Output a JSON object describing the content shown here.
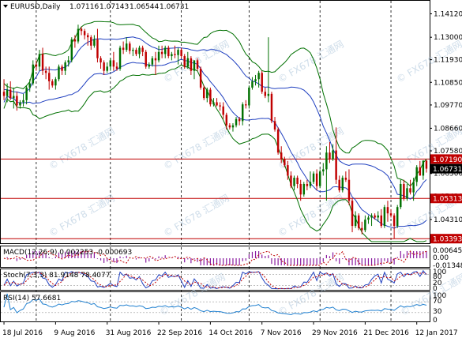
{
  "chart_data": {
    "type": "candlestick",
    "symbol_title": "EURUSD,Daily",
    "ohlc_header": [
      "1.07116",
      "1.07143",
      "1.06544",
      "1.06731"
    ],
    "ohlc": [
      [
        "2016-07-18",
        1.104,
        1.11,
        1.1,
        1.102
      ],
      [
        "2016-07-19",
        1.102,
        1.108,
        1.099,
        1.105
      ],
      [
        "2016-07-20",
        1.105,
        1.109,
        1.1,
        1.101
      ],
      [
        "2016-07-21",
        1.101,
        1.106,
        1.096,
        1.102
      ],
      [
        "2016-07-22",
        1.102,
        1.104,
        1.095,
        1.0975
      ],
      [
        "2016-07-25",
        1.0975,
        1.1,
        1.096,
        1.099
      ],
      [
        "2016-07-26",
        1.099,
        1.103,
        1.097,
        1.1
      ],
      [
        "2016-07-27",
        1.1,
        1.107,
        1.098,
        1.106
      ],
      [
        "2016-07-28",
        1.106,
        1.11,
        1.104,
        1.108
      ],
      [
        "2016-07-29",
        1.108,
        1.119,
        1.107,
        1.117
      ],
      [
        "2016-08-01",
        1.117,
        1.119,
        1.114,
        1.116
      ],
      [
        "2016-08-02",
        1.116,
        1.124,
        1.114,
        1.122
      ],
      [
        "2016-08-03",
        1.122,
        1.125,
        1.112,
        1.114
      ],
      [
        "2016-08-04",
        1.114,
        1.116,
        1.11,
        1.113
      ],
      [
        "2016-08-05",
        1.113,
        1.116,
        1.105,
        1.109
      ],
      [
        "2016-08-08",
        1.109,
        1.11,
        1.106,
        1.107
      ],
      [
        "2016-08-09",
        1.107,
        1.111,
        1.105,
        1.11
      ],
      [
        "2016-08-10",
        1.11,
        1.117,
        1.109,
        1.116
      ],
      [
        "2016-08-11",
        1.116,
        1.117,
        1.112,
        1.114
      ],
      [
        "2016-08-12",
        1.114,
        1.119,
        1.112,
        1.118
      ],
      [
        "2016-08-15",
        1.118,
        1.121,
        1.116,
        1.119
      ],
      [
        "2016-08-16",
        1.119,
        1.13,
        1.118,
        1.129
      ],
      [
        "2016-08-17",
        1.129,
        1.131,
        1.125,
        1.128
      ],
      [
        "2016-08-18",
        1.128,
        1.136,
        1.127,
        1.134
      ],
      [
        "2016-08-19",
        1.134,
        1.135,
        1.131,
        1.133
      ],
      [
        "2016-08-22",
        1.133,
        1.134,
        1.129,
        1.131
      ],
      [
        "2016-08-23",
        1.131,
        1.132,
        1.126,
        1.13
      ],
      [
        "2016-08-24",
        1.13,
        1.131,
        1.124,
        1.126
      ],
      [
        "2016-08-25",
        1.126,
        1.131,
        1.125,
        1.129
      ],
      [
        "2016-08-26",
        1.129,
        1.134,
        1.118,
        1.12
      ],
      [
        "2016-08-29",
        1.12,
        1.121,
        1.115,
        1.118
      ],
      [
        "2016-08-30",
        1.118,
        1.119,
        1.112,
        1.114
      ],
      [
        "2016-08-31",
        1.114,
        1.118,
        1.113,
        1.116
      ],
      [
        "2016-09-01",
        1.116,
        1.12,
        1.114,
        1.119
      ],
      [
        "2016-09-02",
        1.119,
        1.123,
        1.114,
        1.116
      ],
      [
        "2016-09-05",
        1.116,
        1.118,
        1.114,
        1.115
      ],
      [
        "2016-09-06",
        1.115,
        1.126,
        1.114,
        1.125
      ],
      [
        "2016-09-07",
        1.125,
        1.128,
        1.122,
        1.124
      ],
      [
        "2016-09-08",
        1.124,
        1.13,
        1.123,
        1.127
      ],
      [
        "2016-09-09",
        1.127,
        1.128,
        1.122,
        1.1235
      ],
      [
        "2016-09-12",
        1.1235,
        1.125,
        1.121,
        1.124
      ],
      [
        "2016-09-13",
        1.124,
        1.125,
        1.121,
        1.122
      ],
      [
        "2016-09-14",
        1.122,
        1.126,
        1.12,
        1.125
      ],
      [
        "2016-09-15",
        1.125,
        1.126,
        1.121,
        1.123
      ],
      [
        "2016-09-16",
        1.123,
        1.124,
        1.115,
        1.116
      ],
      [
        "2016-09-19",
        1.116,
        1.118,
        1.115,
        1.117
      ],
      [
        "2016-09-20",
        1.117,
        1.121,
        1.116,
        1.12
      ],
      [
        "2016-09-21",
        1.12,
        1.123,
        1.112,
        1.119
      ],
      [
        "2016-09-22",
        1.119,
        1.126,
        1.118,
        1.123
      ],
      [
        "2016-09-23",
        1.123,
        1.126,
        1.12,
        1.122
      ],
      [
        "2016-09-26",
        1.122,
        1.126,
        1.12,
        1.125
      ],
      [
        "2016-09-27",
        1.125,
        1.126,
        1.12,
        1.121
      ],
      [
        "2016-09-28",
        1.121,
        1.123,
        1.119,
        1.122
      ],
      [
        "2016-09-29",
        1.122,
        1.126,
        1.12,
        1.1215
      ],
      [
        "2016-09-30",
        1.1215,
        1.125,
        1.117,
        1.124
      ],
      [
        "2016-10-03",
        1.124,
        1.125,
        1.12,
        1.121
      ],
      [
        "2016-10-04",
        1.121,
        1.122,
        1.115,
        1.116
      ],
      [
        "2016-10-05",
        1.116,
        1.123,
        1.115,
        1.12
      ],
      [
        "2016-10-06",
        1.12,
        1.121,
        1.112,
        1.114
      ],
      [
        "2016-10-07",
        1.114,
        1.119,
        1.11,
        1.119
      ],
      [
        "2016-10-10",
        1.119,
        1.12,
        1.114,
        1.115
      ],
      [
        "2016-10-11",
        1.115,
        1.116,
        1.105,
        1.106
      ],
      [
        "2016-10-12",
        1.106,
        1.107,
        1.1,
        1.101
      ],
      [
        "2016-10-13",
        1.101,
        1.106,
        1.099,
        1.105
      ],
      [
        "2016-10-14",
        1.105,
        1.106,
        1.097,
        1.098
      ],
      [
        "2016-10-17",
        1.098,
        1.101,
        1.097,
        1.099
      ],
      [
        "2016-10-18",
        1.099,
        1.101,
        1.097,
        1.0975
      ],
      [
        "2016-10-19",
        1.0975,
        1.099,
        1.095,
        1.097
      ],
      [
        "2016-10-20",
        1.097,
        1.099,
        1.091,
        1.093
      ],
      [
        "2016-10-21",
        1.093,
        1.094,
        1.086,
        1.088
      ],
      [
        "2016-10-24",
        1.088,
        1.089,
        1.086,
        1.087
      ],
      [
        "2016-10-25",
        1.087,
        1.089,
        1.085,
        1.088
      ],
      [
        "2016-10-26",
        1.088,
        1.092,
        1.087,
        1.091
      ],
      [
        "2016-10-27",
        1.091,
        1.092,
        1.088,
        1.09
      ],
      [
        "2016-10-28",
        1.09,
        1.099,
        1.088,
        1.098
      ],
      [
        "2016-10-31",
        1.098,
        1.1,
        1.096,
        1.0975
      ],
      [
        "2016-11-01",
        1.0975,
        1.107,
        1.096,
        1.106
      ],
      [
        "2016-11-02",
        1.106,
        1.111,
        1.105,
        1.109
      ],
      [
        "2016-11-03",
        1.109,
        1.112,
        1.107,
        1.11
      ],
      [
        "2016-11-04",
        1.11,
        1.114,
        1.106,
        1.113
      ],
      [
        "2016-11-07",
        1.113,
        1.114,
        1.103,
        1.104
      ],
      [
        "2016-11-08",
        1.104,
        1.106,
        1.101,
        1.102
      ],
      [
        "2016-11-09",
        1.102,
        1.13,
        1.099,
        1.103
      ],
      [
        "2016-11-10",
        1.103,
        1.104,
        1.089,
        1.09
      ],
      [
        "2016-11-11",
        1.09,
        1.092,
        1.085,
        1.086
      ],
      [
        "2016-11-14",
        1.086,
        1.087,
        1.074,
        1.075
      ],
      [
        "2016-11-15",
        1.075,
        1.078,
        1.07,
        1.072
      ],
      [
        "2016-11-16",
        1.072,
        1.073,
        1.068,
        1.069
      ],
      [
        "2016-11-17",
        1.069,
        1.071,
        1.062,
        1.064
      ],
      [
        "2016-11-18",
        1.064,
        1.066,
        1.058,
        1.059
      ],
      [
        "2016-11-21",
        1.059,
        1.064,
        1.057,
        1.063
      ],
      [
        "2016-11-22",
        1.063,
        1.064,
        1.058,
        1.06
      ],
      [
        "2016-11-23",
        1.06,
        1.062,
        1.052,
        1.055
      ],
      [
        "2016-11-24",
        1.055,
        1.061,
        1.054,
        1.06
      ],
      [
        "2016-11-25",
        1.06,
        1.062,
        1.057,
        1.059
      ],
      [
        "2016-11-28",
        1.059,
        1.066,
        1.058,
        1.061
      ],
      [
        "2016-11-29",
        1.061,
        1.066,
        1.06,
        1.065
      ],
      [
        "2016-11-30",
        1.065,
        1.067,
        1.057,
        1.059
      ],
      [
        "2016-12-01",
        1.059,
        1.067,
        1.058,
        1.066
      ],
      [
        "2016-12-02",
        1.066,
        1.07,
        1.064,
        1.067
      ],
      [
        "2016-12-05",
        1.067,
        1.078,
        1.052,
        1.075
      ],
      [
        "2016-12-06",
        1.075,
        1.08,
        1.07,
        1.072
      ],
      [
        "2016-12-07",
        1.072,
        1.079,
        1.071,
        1.076
      ],
      [
        "2016-12-08",
        1.076,
        1.087,
        1.06,
        1.062
      ],
      [
        "2016-12-09",
        1.062,
        1.064,
        1.056,
        1.057
      ],
      [
        "2016-12-12",
        1.057,
        1.064,
        1.056,
        1.063
      ],
      [
        "2016-12-13",
        1.063,
        1.066,
        1.061,
        1.062
      ],
      [
        "2016-12-14",
        1.062,
        1.067,
        1.05,
        1.052
      ],
      [
        "2016-12-15",
        1.052,
        1.053,
        1.037,
        1.04
      ],
      [
        "2016-12-16",
        1.04,
        1.047,
        1.039,
        1.045
      ],
      [
        "2016-12-19",
        1.045,
        1.046,
        1.038,
        1.039
      ],
      [
        "2016-12-20",
        1.039,
        1.042,
        1.036,
        1.038
      ],
      [
        "2016-12-21",
        1.038,
        1.045,
        1.037,
        1.043
      ],
      [
        "2016-12-22",
        1.043,
        1.045,
        1.041,
        1.044
      ],
      [
        "2016-12-23",
        1.044,
        1.046,
        1.04,
        1.045
      ],
      [
        "2016-12-26",
        1.045,
        1.046,
        1.043,
        1.044
      ],
      [
        "2016-12-27",
        1.044,
        1.047,
        1.042,
        1.045
      ],
      [
        "2016-12-28",
        1.045,
        1.048,
        1.039,
        1.04
      ],
      [
        "2016-12-29",
        1.04,
        1.05,
        1.039,
        1.049
      ],
      [
        "2016-12-30",
        1.049,
        1.052,
        1.042,
        1.046
      ],
      [
        "2017-01-02",
        1.046,
        1.048,
        1.044,
        1.045
      ],
      [
        "2017-01-03",
        1.045,
        1.046,
        1.034,
        1.04
      ],
      [
        "2017-01-04",
        1.04,
        1.05,
        1.039,
        1.049
      ],
      [
        "2017-01-05",
        1.049,
        1.062,
        1.048,
        1.06
      ],
      [
        "2017-01-06",
        1.06,
        1.062,
        1.052,
        1.053
      ],
      [
        "2017-01-09",
        1.053,
        1.06,
        1.052,
        1.058
      ],
      [
        "2017-01-10",
        1.058,
        1.062,
        1.055,
        1.056
      ],
      [
        "2017-01-11",
        1.056,
        1.063,
        1.052,
        1.061
      ],
      [
        "2017-01-12",
        1.061,
        1.069,
        1.059,
        1.068
      ],
      [
        "2017-01-13",
        1.068,
        1.071,
        1.064,
        1.064
      ],
      [
        "2017-01-16",
        1.064,
        1.071,
        1.062,
        1.0712
      ],
      [
        "2017-01-17",
        1.07116,
        1.07143,
        1.06544,
        1.06731
      ]
    ],
    "price_axis": {
      "ylim": [
        1.0325,
        1.1425
      ],
      "ticks": [
        "1.14120",
        "1.13000",
        "1.11930",
        "1.10850",
        "1.09770",
        "1.08660",
        "1.07580",
        "1.06500",
        "1.05420",
        "1.04310"
      ],
      "tick_values": [
        1.1412,
        1.13,
        1.1193,
        1.1085,
        1.0977,
        1.0866,
        1.0758,
        1.065,
        1.0542,
        1.0431
      ]
    },
    "horizontal_lines": [
      {
        "value": 1.0719,
        "label": "1.07190",
        "color": "#c00000"
      },
      {
        "value": 1.05313,
        "label": "1.05313",
        "color": "#c00000"
      },
      {
        "value": 1.03393,
        "label": "1.03393",
        "color": "#c00000"
      }
    ],
    "last_price": {
      "value": 1.06731,
      "label": "1.06731"
    },
    "overlay_lines": [
      {
        "kind": "bollinger_outer",
        "color": "#007000"
      },
      {
        "kind": "bollinger_inner",
        "color": "#2040c0"
      },
      {
        "kind": "bollinger_middle",
        "color": "#2040c0"
      }
    ],
    "x_ticks": [
      "18 Jul 2016",
      "9 Aug 2016",
      "31 Aug 2016",
      "22 Sep 2016",
      "14 Oct 2016",
      "7 Nov 2016",
      "29 Nov 2016",
      "21 Dec 2016",
      "12 Jan 2017"
    ],
    "x_tick_dates": [
      "2016-07-18",
      "2016-08-09",
      "2016-08-31",
      "2016-09-22",
      "2016-10-14",
      "2016-11-07",
      "2016-11-29",
      "2016-12-21",
      "2017-01-12"
    ],
    "vertical_marker_dates": [
      "2016-08-01",
      "2016-09-01",
      "2016-10-03",
      "2016-11-01",
      "2016-12-01",
      "2017-01-02"
    ],
    "macd": {
      "title": "MACD(12,26,9) 0.002253 -0.000693",
      "axis_labels": [
        "0.006451",
        "0.00",
        "-0.013484"
      ]
    },
    "stoch": {
      "title": "Stoch(7,3,3) 81.9148 78.4077",
      "axis_labels": [
        "100",
        "80",
        "20",
        "0"
      ]
    },
    "rsi": {
      "title": "RSI(14) 57.6681",
      "axis_labels": [
        "100",
        "70",
        "30",
        "0"
      ]
    },
    "watermark": "FX678 汇通网",
    "colors": {
      "up": "#007000",
      "down": "#c00000",
      "grid": "#000000",
      "label_bg_black": "#000000",
      "label_bg_red": "#c00000",
      "macd_signal": "#c00000",
      "stoch_main": "#2040c0",
      "stoch_signal": "#c00000",
      "rsi_line": "#2080d0"
    }
  }
}
